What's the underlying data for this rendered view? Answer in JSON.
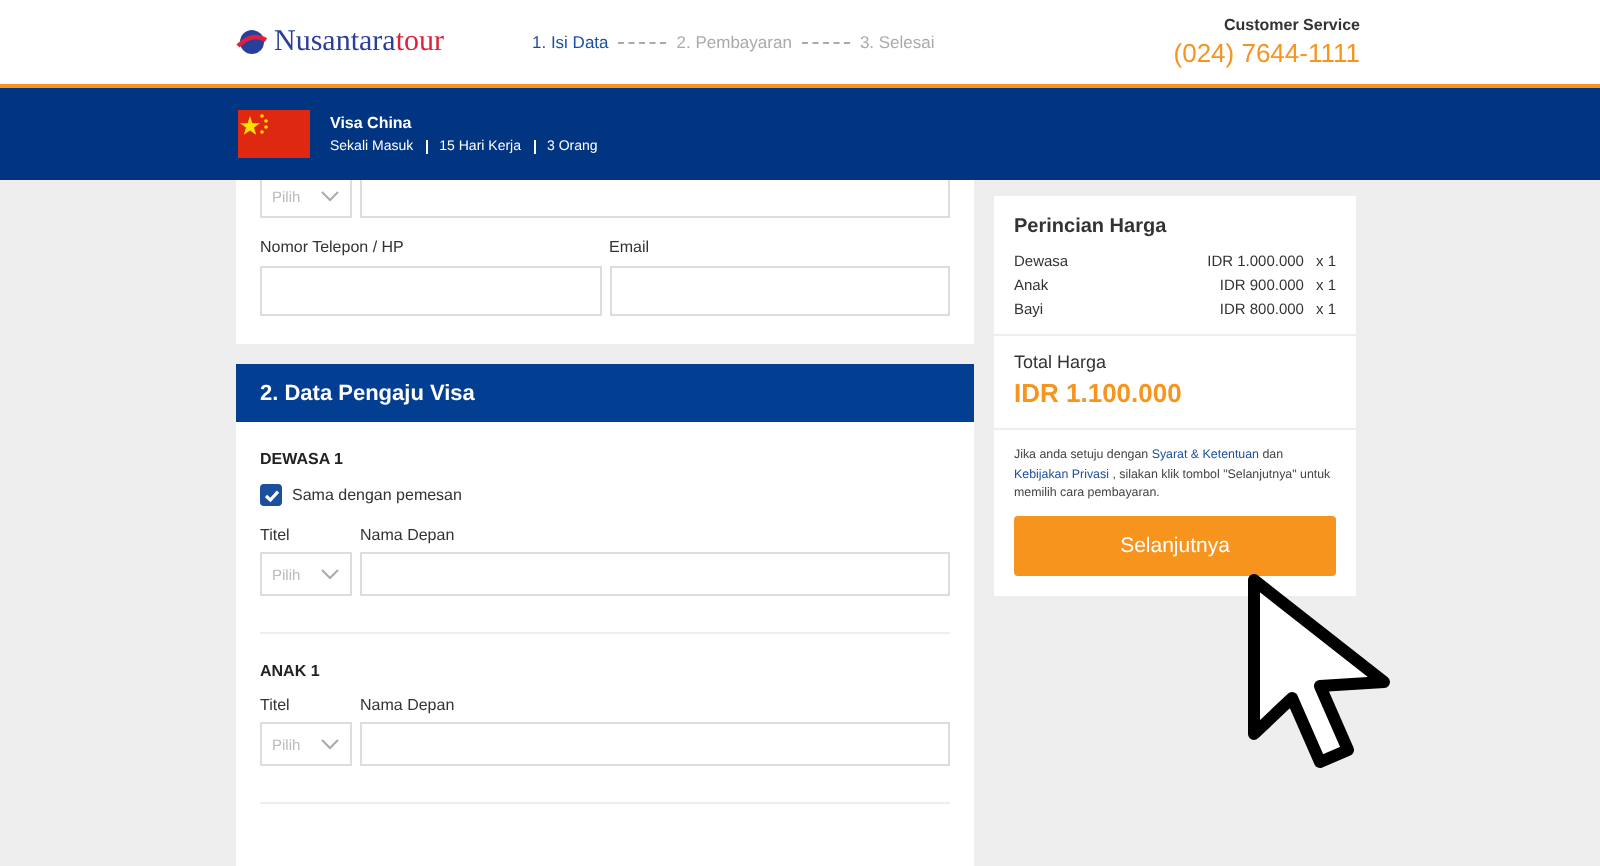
{
  "header": {
    "logo": {
      "main": "Nusantara",
      "accent": "tour"
    },
    "steps": [
      {
        "label": "1. Isi Data",
        "selected": true
      },
      {
        "label": "2. Pembayaran",
        "selected": false
      },
      {
        "label": "3. Selesai",
        "selected": false
      }
    ],
    "customer_service": {
      "label": "Customer Service",
      "phone": "(024) 7644-1111"
    }
  },
  "banner": {
    "title": "Visa China",
    "details": [
      "Sekali Masuk",
      "15 Hari Kerja",
      "3 Orang"
    ]
  },
  "contact_card": {
    "select_placeholder": "Pilih",
    "fields": [
      {
        "label": "Nomor Telepon / HP"
      },
      {
        "label": "Email"
      }
    ]
  },
  "applicant_section": {
    "title": "2. Data Pengaju Visa",
    "applicants": [
      {
        "heading": "DEWASA 1",
        "same_as_booker": {
          "label": "Sama dengan pemesan",
          "checked": true
        },
        "title_label": "Titel",
        "name_label": "Nama Depan",
        "select_placeholder": "Pilih"
      },
      {
        "heading": "ANAK 1",
        "title_label": "Titel",
        "name_label": "Nama Depan",
        "select_placeholder": "Pilih"
      }
    ]
  },
  "price_card": {
    "title": "Perincian Harga",
    "items": [
      {
        "name": "Dewasa",
        "price": "IDR 1.000.000",
        "qty": "x 1"
      },
      {
        "name": "Anak",
        "price": "IDR 900.000",
        "qty": "x 1"
      },
      {
        "name": "Bayi",
        "price": "IDR 800.000",
        "qty": "x 1"
      }
    ],
    "total_label": "Total Harga",
    "total": "IDR 1.100.000",
    "terms": [
      {
        "kind": "text",
        "text": "Jika anda setuju dengan"
      },
      {
        "kind": "link",
        "text": "Syarat & Ketentuan"
      },
      {
        "kind": "text",
        "text": "dan"
      },
      {
        "kind": "link",
        "text": "Kebijakan Privasi"
      },
      {
        "kind": "text",
        "text": ", silakan klik tombol \"Selanjutnya\" untuk memilih cara pembayaran."
      }
    ],
    "button": "Selanjutnya"
  }
}
